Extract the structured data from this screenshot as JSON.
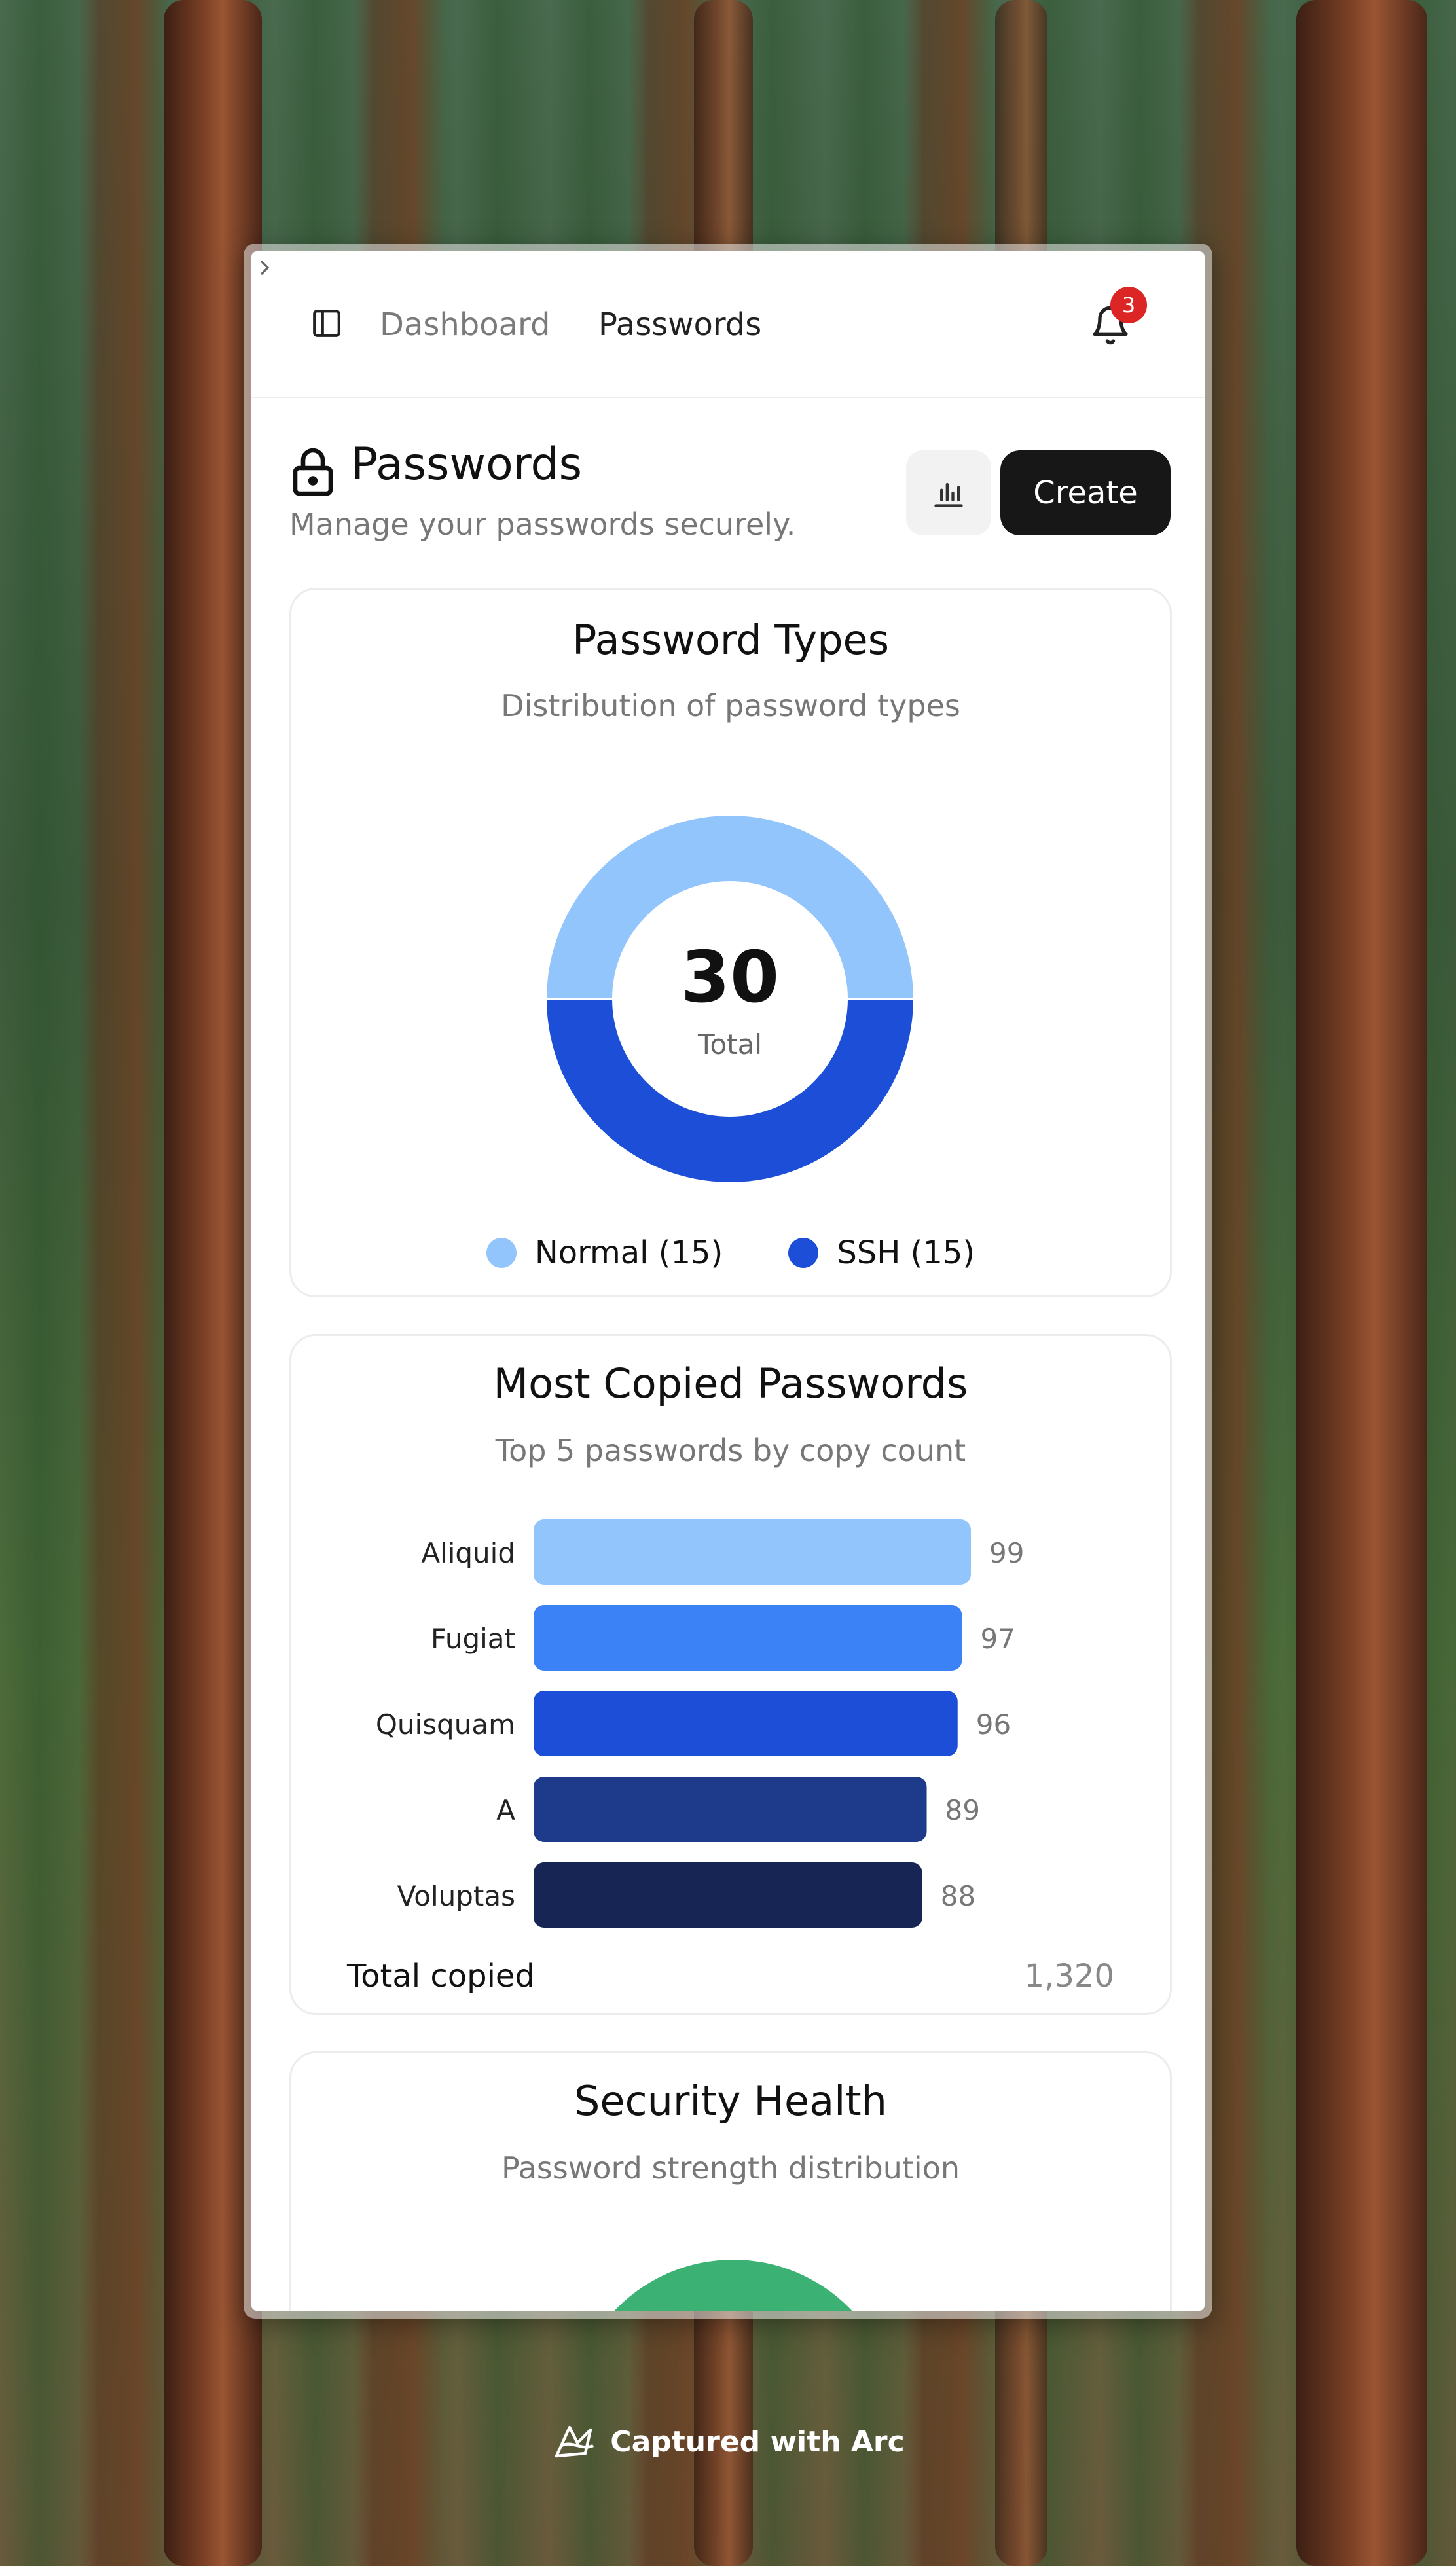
{
  "breadcrumb": {
    "parent": "Dashboard",
    "current": "Passwords"
  },
  "notifications": {
    "count": "3"
  },
  "header": {
    "title": "Passwords",
    "subtitle": "Manage your passwords securely.",
    "create_label": "Create"
  },
  "types_card": {
    "title": "Password Types",
    "subtitle": "Distribution of password types",
    "center_value": "30",
    "center_label": "Total",
    "legend": [
      {
        "label": "Normal (15)",
        "color": "#93c5fd"
      },
      {
        "label": "SSH (15)",
        "color": "#1d4ed8"
      }
    ]
  },
  "copied_card": {
    "title": "Most Copied Passwords",
    "subtitle": "Top 5 passwords by copy count",
    "total_label": "Total copied",
    "total_value": "1,320"
  },
  "health_card": {
    "title": "Security Health",
    "subtitle": "Password strength distribution",
    "color": "#3bb273"
  },
  "capture": {
    "label": "Captured with Arc"
  },
  "chart_data": [
    {
      "type": "pie",
      "title": "Password Types",
      "categories": [
        "Normal",
        "SSH"
      ],
      "values": [
        15,
        15
      ],
      "colors": [
        "#93c5fd",
        "#1d4ed8"
      ],
      "legend": "bottom"
    },
    {
      "type": "bar",
      "orientation": "horizontal",
      "title": "Most Copied Passwords",
      "categories": [
        "Aliquid",
        "Fugiat",
        "Quisquam",
        "A",
        "Voluptas"
      ],
      "values": [
        99,
        97,
        96,
        89,
        88
      ],
      "colors": [
        "#93c5fd",
        "#3b82f6",
        "#1d4ed8",
        "#1e3a8a",
        "#172554"
      ],
      "xlim": [
        0,
        110
      ],
      "grid": false
    }
  ]
}
